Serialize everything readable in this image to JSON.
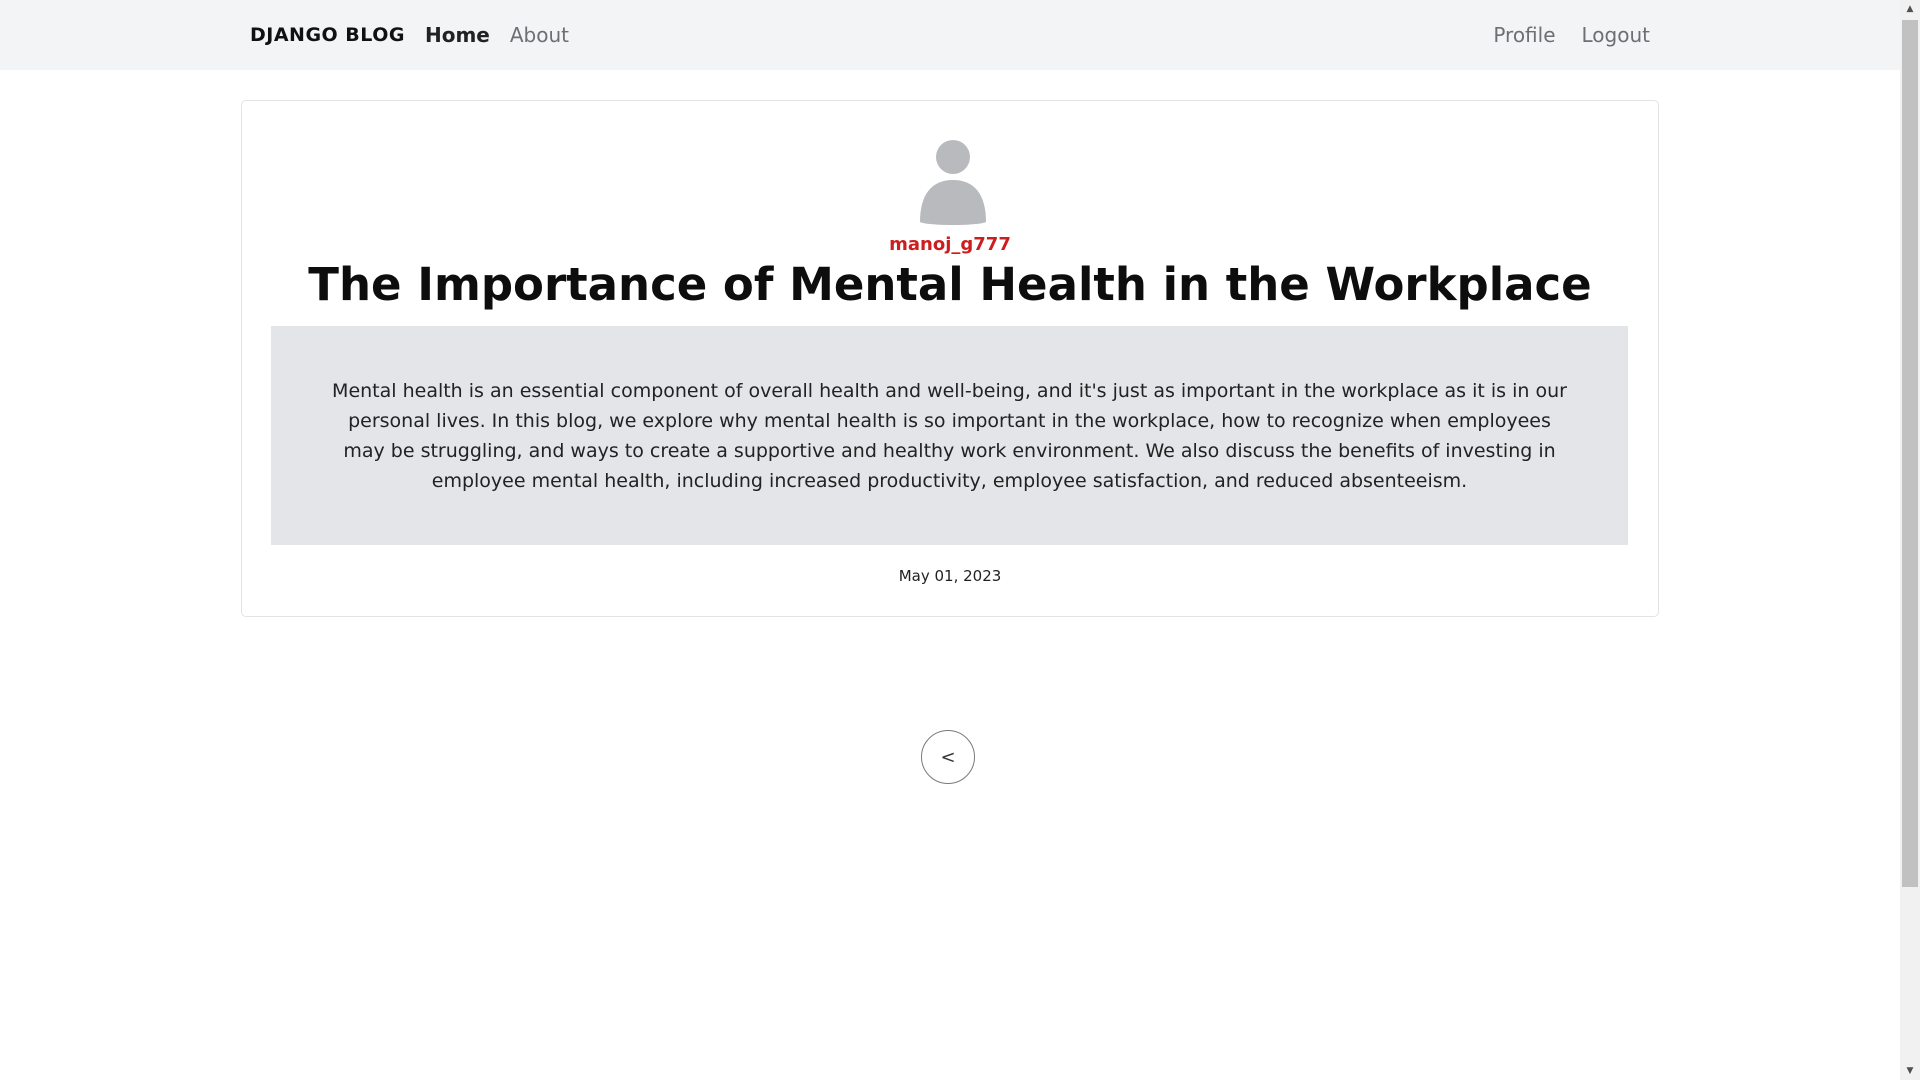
{
  "navbar": {
    "brand": "DJANGO BLOG",
    "links_left": [
      {
        "label": "Home",
        "active": true
      },
      {
        "label": "About",
        "active": false
      }
    ],
    "links_right": [
      {
        "label": "Profile"
      },
      {
        "label": "Logout"
      }
    ]
  },
  "post": {
    "avatar_icon": "user-silhouette-icon",
    "author": "manoj_g777",
    "title": "The Importance of Mental Health in the Workplace",
    "content": "Mental health is an essential component of overall health and well-being, and it's just as important in the workplace as it is in our personal lives. In this blog, we explore why mental health is so important in the workplace, how to recognize when employees may be struggling, and ways to create a supportive and healthy work environment. We also discuss the benefits of investing in employee mental health, including increased productivity, employee satisfaction, and reduced absenteeism.",
    "date": "May 01, 2023"
  },
  "pagination": {
    "back_label": "<"
  },
  "colors": {
    "navbar_bg": "#f3f4f5",
    "author": "#cc1e1e",
    "content_bg": "#e4e5e8"
  }
}
